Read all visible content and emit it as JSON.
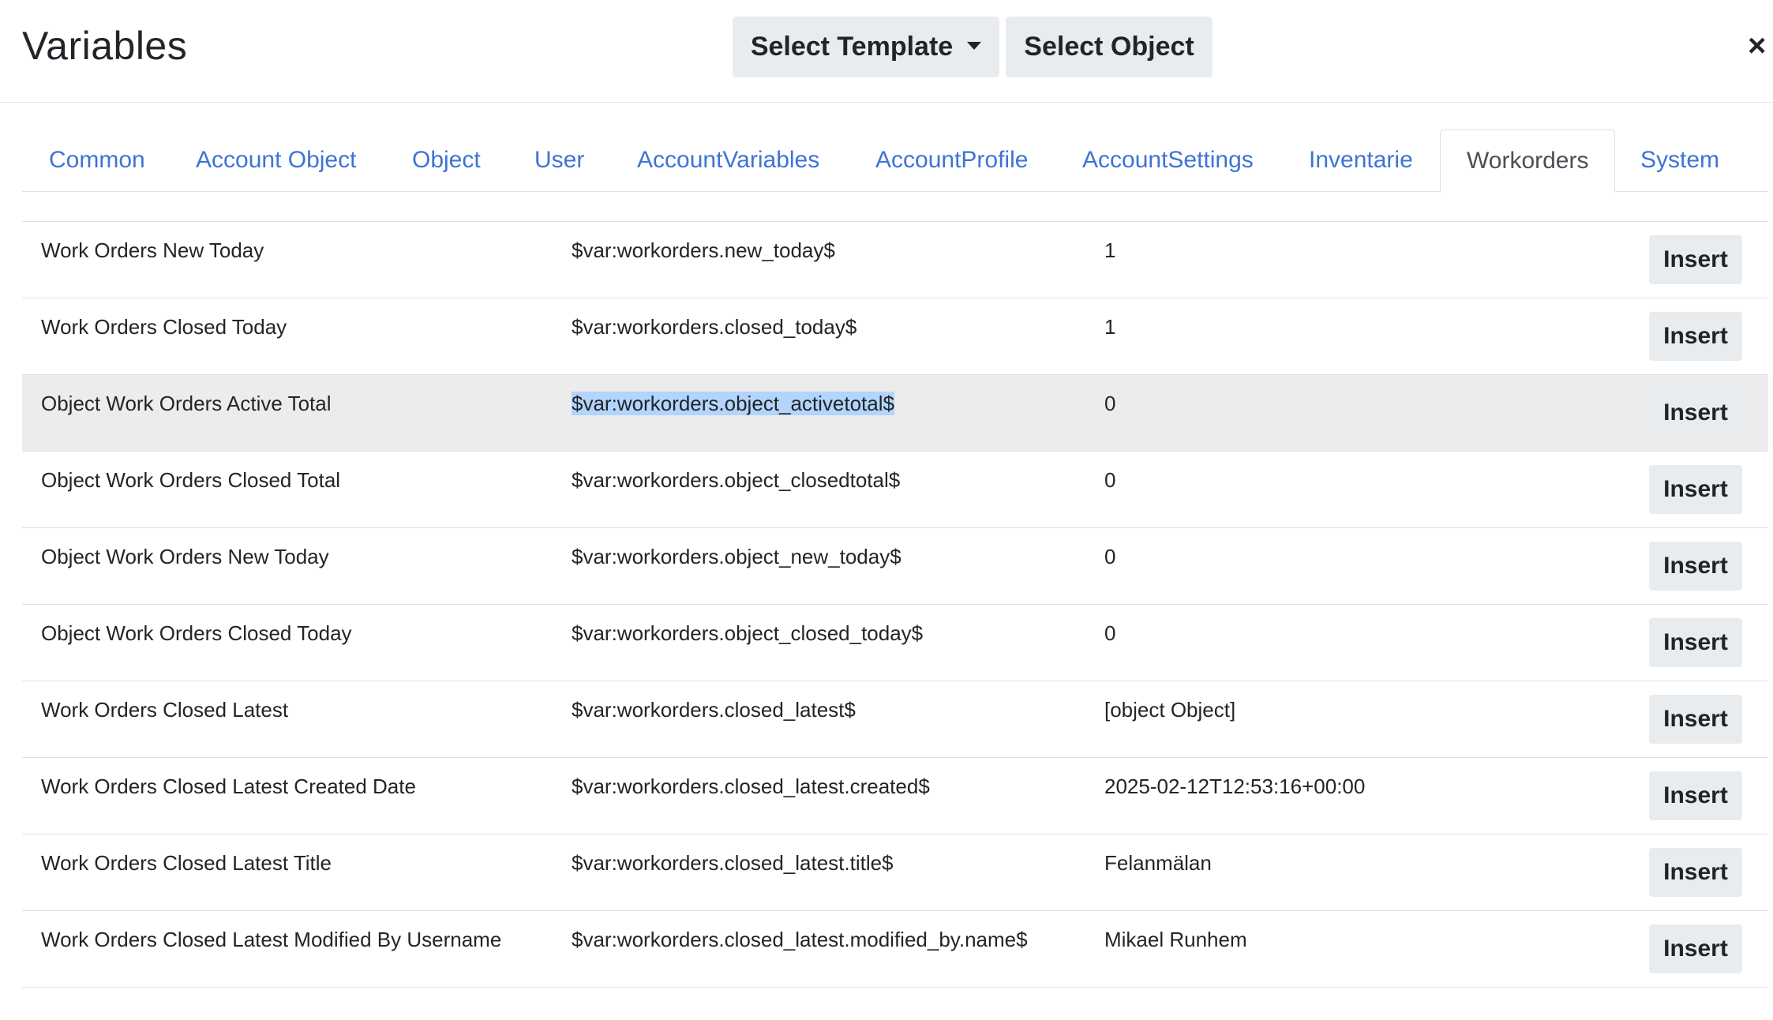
{
  "header": {
    "title": "Variables",
    "select_template_label": "Select Template",
    "select_object_label": "Select Object",
    "close_symbol": "×"
  },
  "tabs": [
    {
      "label": "Common",
      "active": false
    },
    {
      "label": "Account Object",
      "active": false
    },
    {
      "label": "Object",
      "active": false
    },
    {
      "label": "User",
      "active": false
    },
    {
      "label": "AccountVariables",
      "active": false
    },
    {
      "label": "AccountProfile",
      "active": false
    },
    {
      "label": "AccountSettings",
      "active": false
    },
    {
      "label": "Inventarie",
      "active": false
    },
    {
      "label": "Workorders",
      "active": true
    },
    {
      "label": "System",
      "active": false
    }
  ],
  "rows": [
    {
      "name": "Work Orders New Today",
      "variable": "$var:workorders.new_today$",
      "value": "1",
      "button": "Insert"
    },
    {
      "name": "Work Orders Closed Today",
      "variable": "$var:workorders.closed_today$",
      "value": "1",
      "button": "Insert"
    },
    {
      "name": "Object Work Orders Active Total",
      "variable": "$var:workorders.object_activetotal$",
      "value": "0",
      "button": "Insert",
      "highlighted": true
    },
    {
      "name": "Object Work Orders Closed Total",
      "variable": "$var:workorders.object_closedtotal$",
      "value": "0",
      "button": "Insert"
    },
    {
      "name": "Object Work Orders New Today",
      "variable": "$var:workorders.object_new_today$",
      "value": "0",
      "button": "Insert"
    },
    {
      "name": "Object Work Orders Closed Today",
      "variable": "$var:workorders.object_closed_today$",
      "value": "0",
      "button": "Insert"
    },
    {
      "name": "Work Orders Closed Latest",
      "variable": "$var:workorders.closed_latest$",
      "value": "[object Object]",
      "button": "Insert"
    },
    {
      "name": "Work Orders Closed Latest Created Date",
      "variable": "$var:workorders.closed_latest.created$",
      "value": "2025-02-12T12:53:16+00:00",
      "button": "Insert"
    },
    {
      "name": "Work Orders Closed Latest Title",
      "variable": "$var:workorders.closed_latest.title$",
      "value": "Felanmälan",
      "button": "Insert"
    },
    {
      "name": "Work Orders Closed Latest Modified By Username",
      "variable": "$var:workorders.closed_latest.modified_by.name$",
      "value": "Mikael Runhem",
      "button": "Insert"
    }
  ],
  "colors": {
    "link": "#3e73d6",
    "button_bg": "#e9ecef",
    "row_highlight": "#ececec",
    "text_selection": "#b3d4fc"
  }
}
